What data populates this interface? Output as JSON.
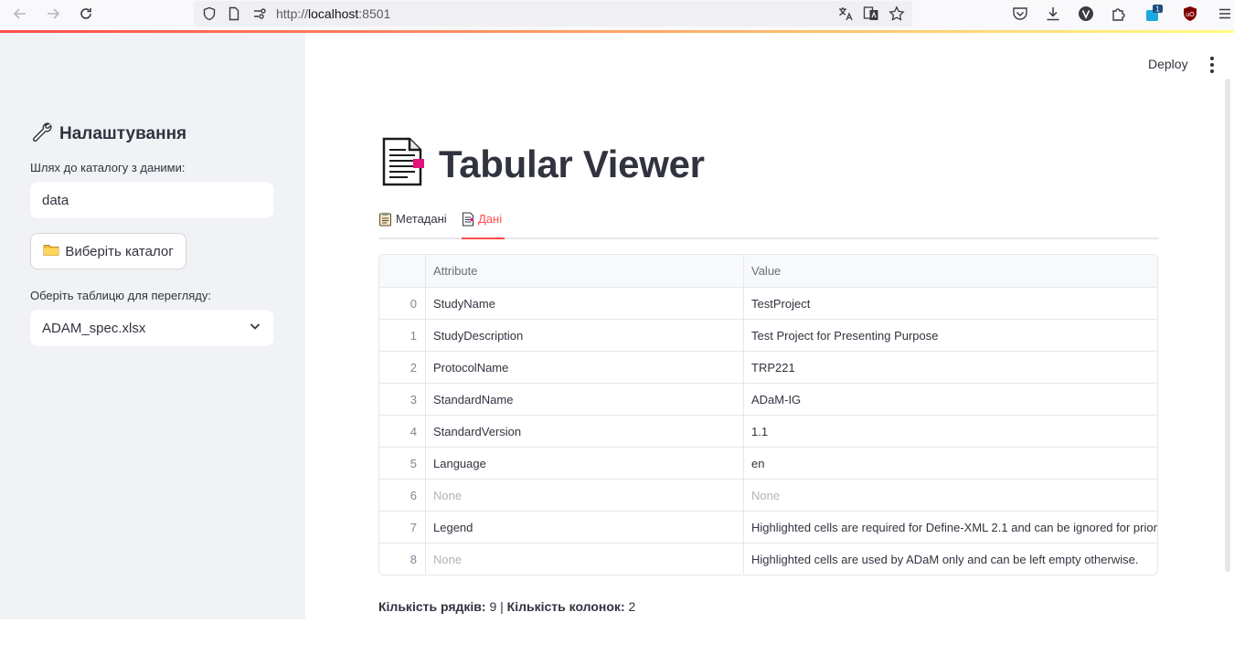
{
  "browser": {
    "url_prefix": "http://",
    "url_host": "localhost",
    "url_suffix": ":8501",
    "extension_badge": "1"
  },
  "sidebar": {
    "title": "Налаштування",
    "path_label": "Шлях до каталогу з даними:",
    "path_value": "data",
    "choose_button": "Виберіть каталог",
    "table_label": "Оберіть таблицю для перегляду:",
    "table_value": "ADAM_spec.xlsx"
  },
  "header": {
    "deploy": "Deploy"
  },
  "main": {
    "title": "Tabular Viewer",
    "tabs": [
      {
        "label": "Метадані",
        "active": false
      },
      {
        "label": "Дані",
        "active": true
      }
    ]
  },
  "table": {
    "columns": [
      "",
      "Attribute",
      "Value"
    ],
    "rows": [
      {
        "index": "0",
        "attribute": "StudyName",
        "value": "TestProject"
      },
      {
        "index": "1",
        "attribute": "StudyDescription",
        "value": "Test Project for Presenting Purpose"
      },
      {
        "index": "2",
        "attribute": "ProtocolName",
        "value": "TRP221"
      },
      {
        "index": "3",
        "attribute": "StandardName",
        "value": "ADaM-IG"
      },
      {
        "index": "4",
        "attribute": "StandardVersion",
        "value": "1.1"
      },
      {
        "index": "5",
        "attribute": "Language",
        "value": "en"
      },
      {
        "index": "6",
        "attribute": "None",
        "value": "None"
      },
      {
        "index": "7",
        "attribute": "Legend",
        "value": "Highlighted cells are required for Define-XML 2.1 and can be ignored for prior"
      },
      {
        "index": "8",
        "attribute": "None",
        "value": "Highlighted cells are used by ADaM only and can be left empty otherwise."
      }
    ]
  },
  "summary": {
    "rows_label": "Кількість рядків:",
    "rows_value": "9",
    "separator": "|",
    "cols_label": "Кількість колонок:",
    "cols_value": "2"
  },
  "colors": {
    "accent": "#ff4b4b",
    "sidebar_bg": "#f0f2f6",
    "text": "#31333f"
  }
}
